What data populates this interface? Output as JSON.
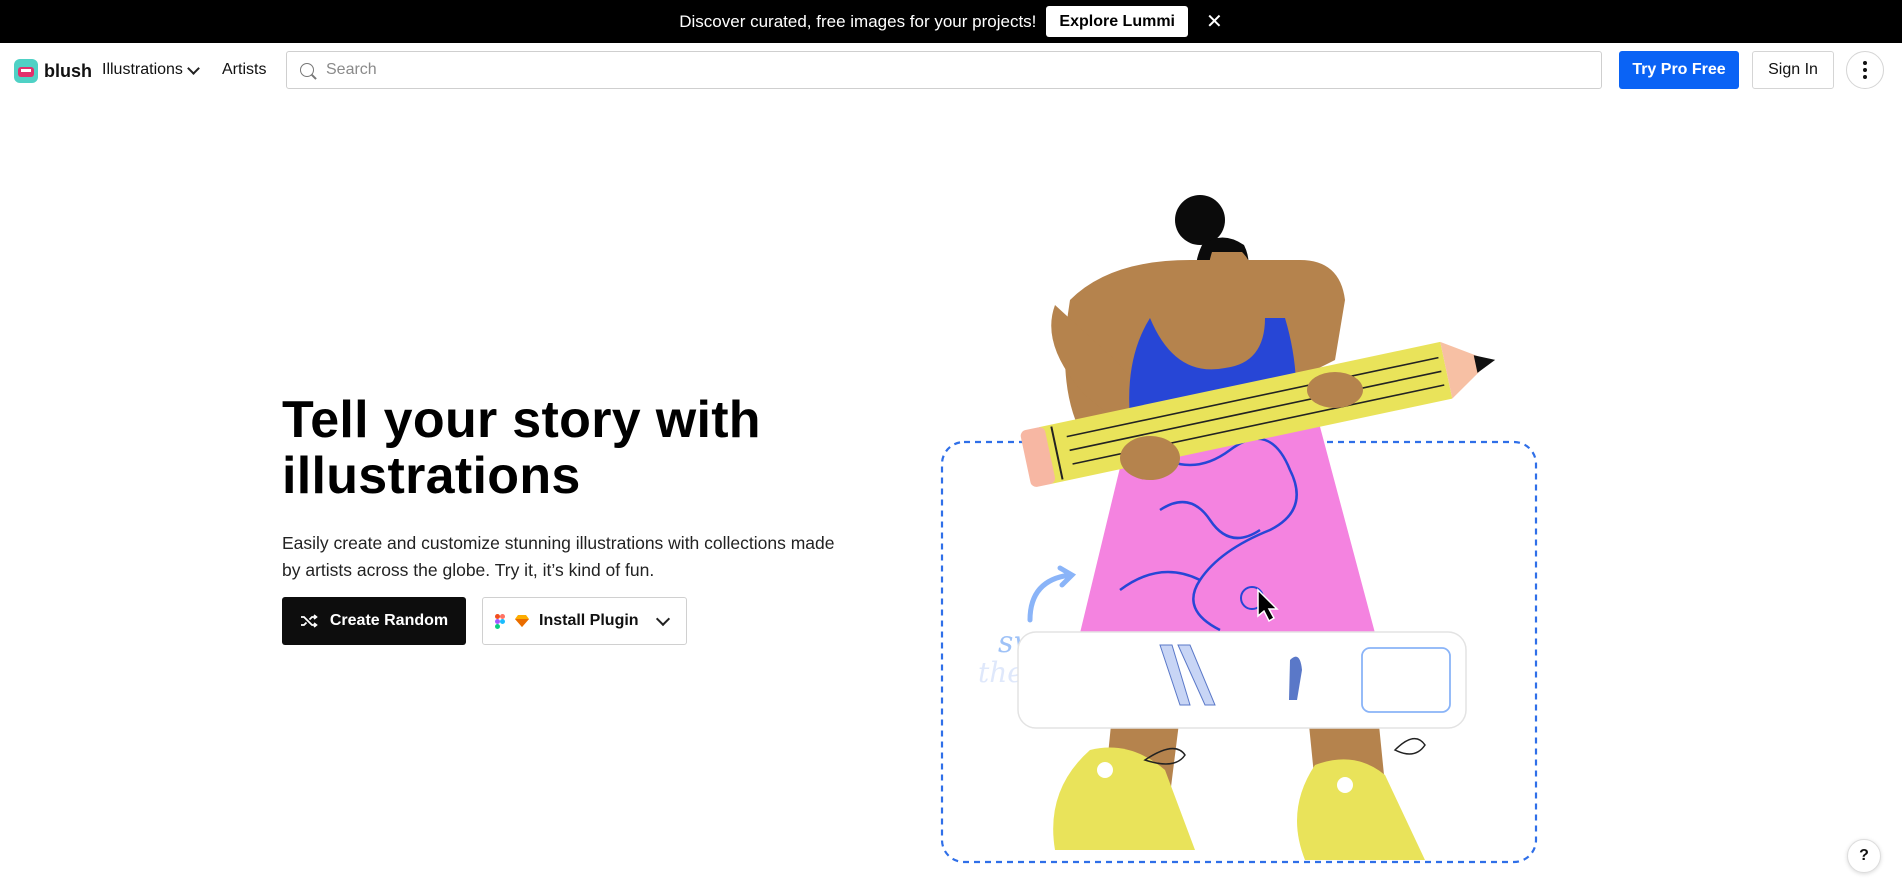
{
  "promo": {
    "text": "Discover curated, free images for your projects!",
    "button_label": "Explore Lummi",
    "close_icon": "close-icon"
  },
  "nav": {
    "logo_text": "blush",
    "illustrations_label": "Illustrations",
    "artists_label": "Artists",
    "search_placeholder": "Search",
    "search_value": "",
    "try_pro_label": "Try Pro Free",
    "sign_in_label": "Sign In",
    "more_icon": "more-vertical-icon"
  },
  "hero": {
    "title": "Tell your story with illustrations",
    "subtitle": "Easily create and customize stunning illustrations with collections made by artists across the globe. Try it, it’s kind of fun.",
    "create_random_label": "Create Random",
    "install_plugin_label": "Install Plugin"
  },
  "illustration": {
    "swap_text": "swap",
    "the_text": "the"
  },
  "help_label": "?",
  "colors": {
    "brand_blue": "#0a63f5",
    "black": "#000000",
    "pencil_yellow": "#e9e35a",
    "dress_pink": "#f483e0",
    "top_blue": "#2746d6",
    "skin": "#b5834d"
  }
}
